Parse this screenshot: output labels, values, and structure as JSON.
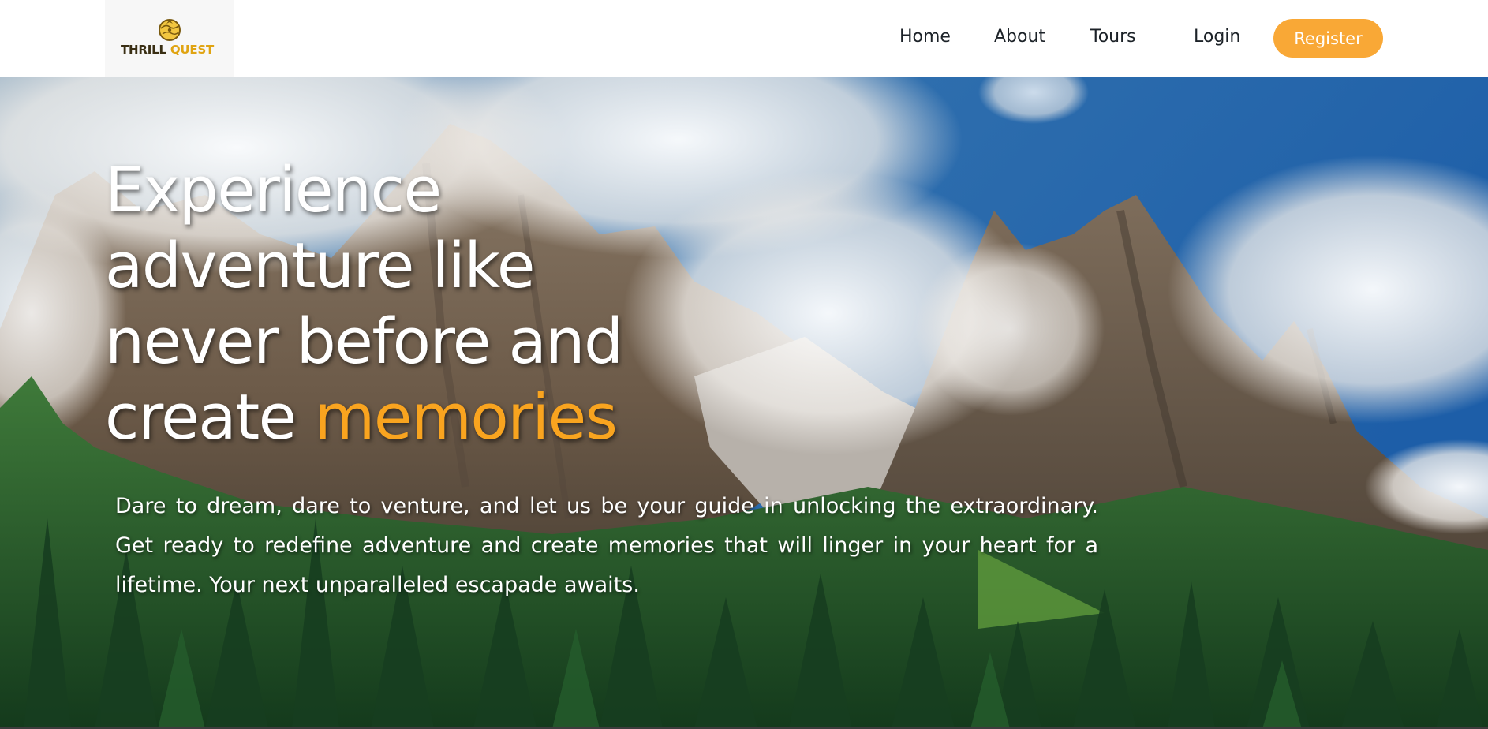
{
  "brand": {
    "logo_word1": "THRILL",
    "logo_word2": "QUEST",
    "colors": {
      "dark": "#3a2f14",
      "gold": "#e0a412"
    },
    "icon": "globe-compass-icon"
  },
  "nav": {
    "links": [
      {
        "label": "Home"
      },
      {
        "label": "About"
      },
      {
        "label": "Tours"
      }
    ],
    "login_label": "Login",
    "register_label": "Register",
    "accent_color": "#f9a836"
  },
  "hero": {
    "heading_lines": [
      "Experience",
      "adventure like",
      "never before and"
    ],
    "heading_last_prefix": "create ",
    "heading_accent": "memories",
    "paragraph": "Dare to dream, dare to venture, and let us be your guide in unlocking the extraordinary. Get ready to redefine adventure and create memories that will linger in your heart for a lifetime. Your next unparalleled escapade awaits.",
    "accent_color": "#f9a41f",
    "background": "mountain-landscape-image"
  }
}
